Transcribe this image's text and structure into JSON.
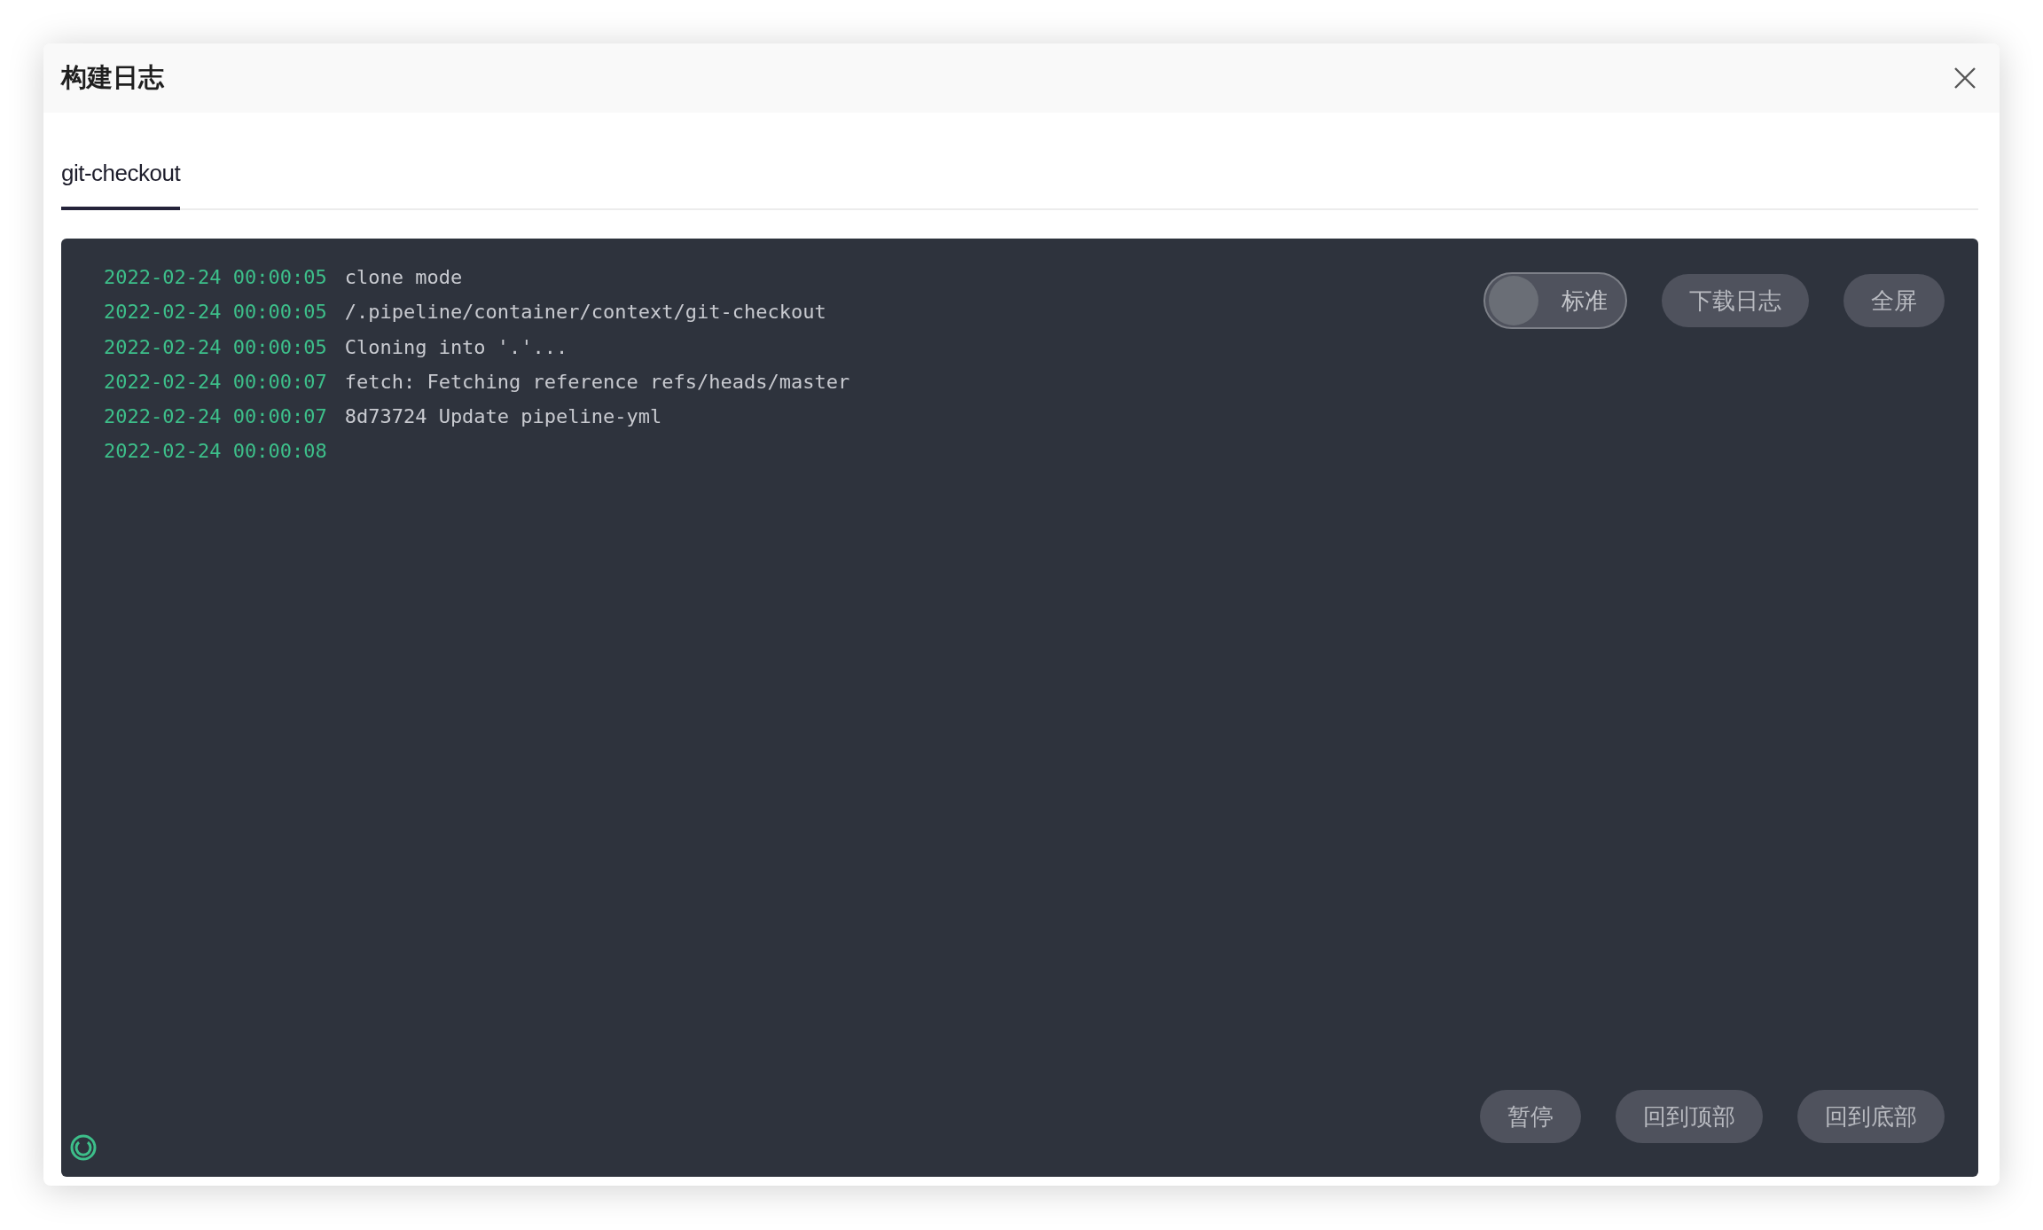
{
  "dialog": {
    "title": "构建日志"
  },
  "tabs": [
    {
      "label": "git-checkout",
      "selected": true
    }
  ],
  "log": {
    "lines": [
      {
        "time": "2022-02-24 00:00:05",
        "text": "clone mode"
      },
      {
        "time": "2022-02-24 00:00:05",
        "text": "/.pipeline/container/context/git-checkout"
      },
      {
        "time": "2022-02-24 00:00:05",
        "text": "Cloning into '.'..."
      },
      {
        "time": "2022-02-24 00:00:07",
        "text": "fetch: Fetching reference refs/heads/master"
      },
      {
        "time": "2022-02-24 00:00:07",
        "text": "8d73724 Update pipeline-yml"
      },
      {
        "time": "2022-02-24 00:00:08"
      }
    ],
    "mode_toggle": {
      "label": "标准",
      "on": false
    },
    "top_buttons": [
      "下载日志",
      "全屏"
    ],
    "bottom_buttons": [
      "暂停",
      "回到顶部",
      "回到底部"
    ],
    "loading": true
  }
}
